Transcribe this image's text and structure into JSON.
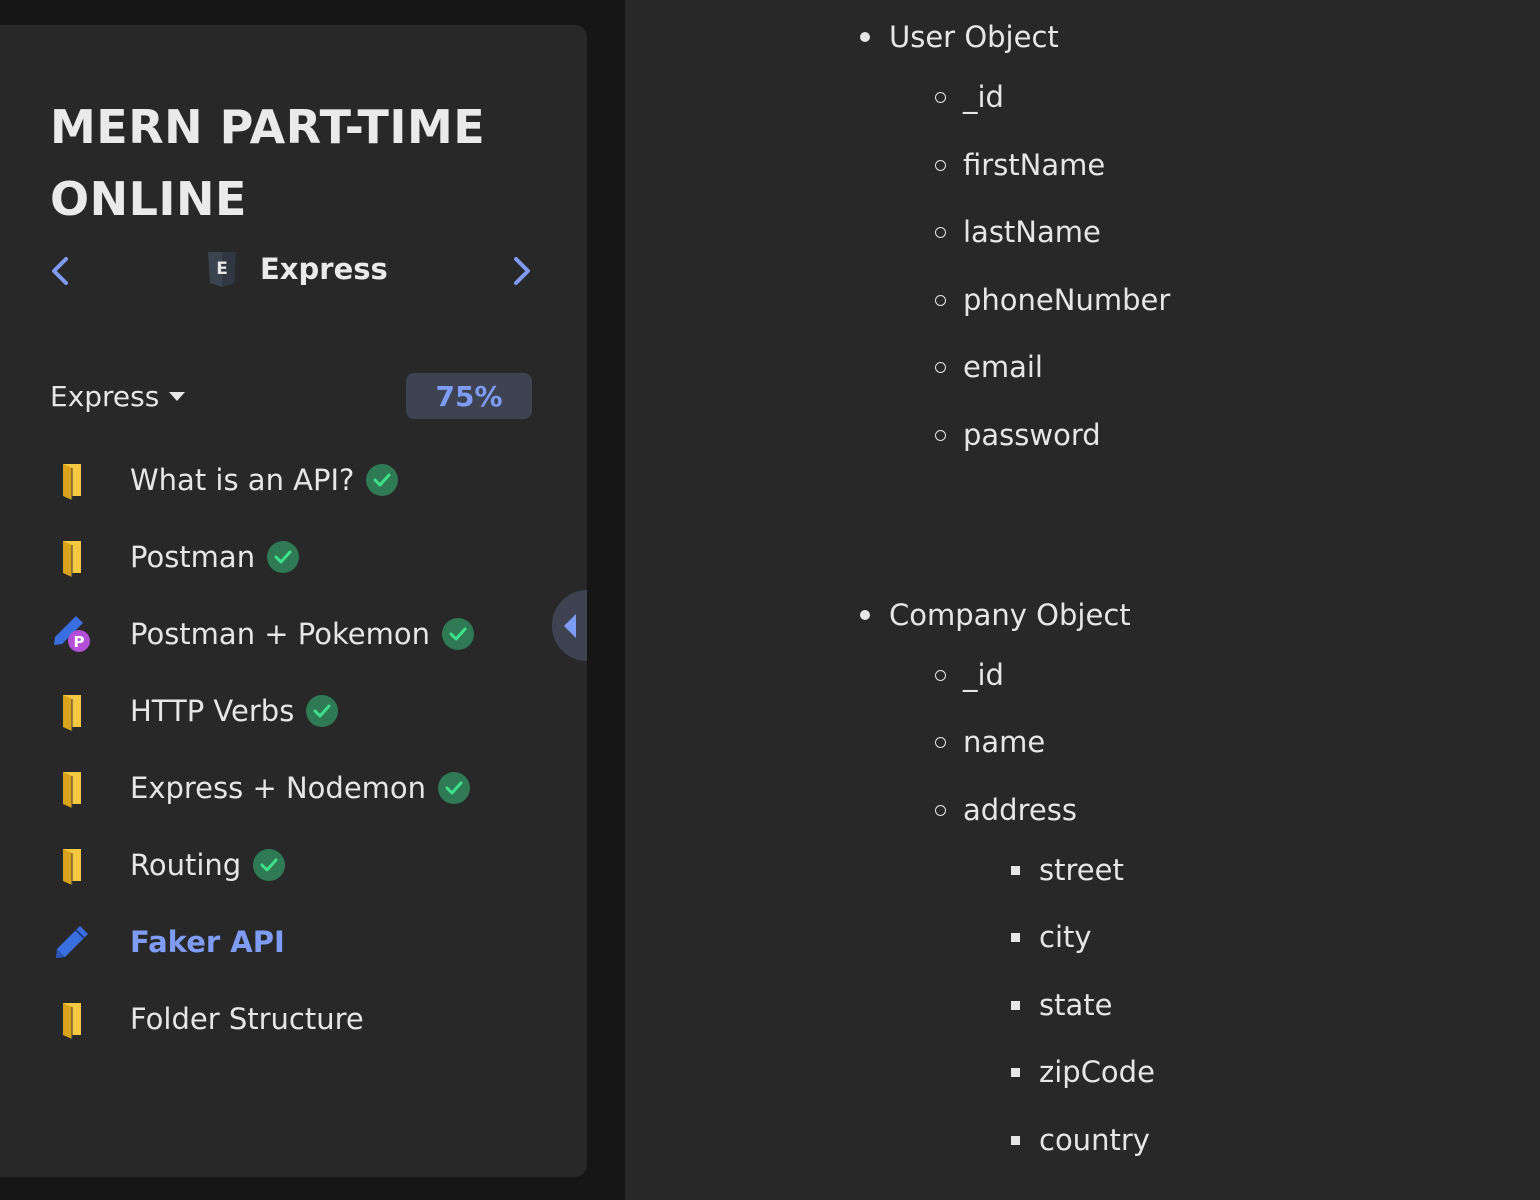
{
  "sidebar": {
    "course_title": "MERN PART-TIME ONLINE",
    "unit": {
      "name": "Express",
      "icon": "express-e-icon"
    },
    "section": {
      "name": "Express",
      "progress": "75%"
    },
    "lessons": [
      {
        "label": "What is an API?",
        "icon": "book-icon",
        "complete": true
      },
      {
        "label": "Postman",
        "icon": "book-icon",
        "complete": true
      },
      {
        "label": "Postman + Pokemon",
        "icon": "pencil-practice-icon",
        "complete": true
      },
      {
        "label": "HTTP Verbs",
        "icon": "book-icon",
        "complete": true
      },
      {
        "label": "Express + Nodemon",
        "icon": "book-icon",
        "complete": true
      },
      {
        "label": "Routing",
        "icon": "book-icon",
        "complete": true
      },
      {
        "label": "Faker API",
        "icon": "pencil-icon",
        "complete": false,
        "active": true
      },
      {
        "label": "Folder Structure",
        "icon": "book-icon",
        "complete": false
      }
    ]
  },
  "content": {
    "user_object": {
      "label": "User Object",
      "fields": [
        "_id",
        "firstName",
        "lastName",
        "phoneNumber",
        "email",
        "password"
      ]
    },
    "company_object": {
      "label": "Company Object",
      "fields": [
        "_id",
        "name",
        "address"
      ],
      "address_fields": [
        "street",
        "city",
        "state",
        "zipCode",
        "country"
      ]
    }
  },
  "colors": {
    "accent": "#7f9cf5",
    "check_green": "#2f7a55",
    "book_yellow": "#f5c842"
  }
}
